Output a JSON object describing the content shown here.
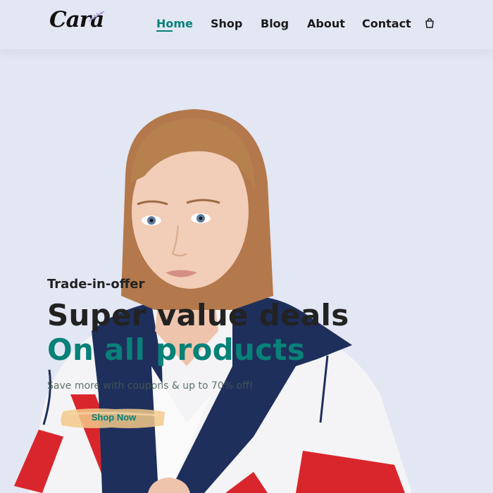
{
  "header": {
    "logo_text": "Cara",
    "nav": [
      {
        "label": "Home",
        "active": true
      },
      {
        "label": "Shop",
        "active": false
      },
      {
        "label": "Blog",
        "active": false
      },
      {
        "label": "About",
        "active": false
      },
      {
        "label": "Contact",
        "active": false
      }
    ],
    "cart_icon": "shopping-bag-icon"
  },
  "hero": {
    "kicker": "Trade-in-offer",
    "title_line1": "Super value deals",
    "title_line2": "On all products",
    "subtitle": "Save more with coupons & up to 70% off!",
    "cta_label": "Shop Now"
  },
  "colors": {
    "background": "#e3e6f3",
    "accent": "#088178",
    "heading": "#222222",
    "button_brush": "#f2c98a"
  }
}
